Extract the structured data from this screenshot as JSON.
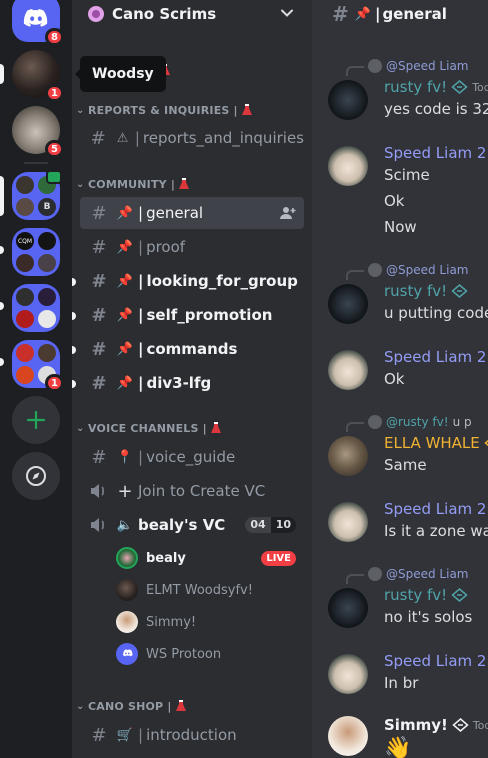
{
  "tooltip": "Woodsy",
  "rail": {
    "badges": [
      "8",
      "1",
      "5",
      "1"
    ],
    "mini_letter": "B",
    "mini_label_1": "CQM"
  },
  "guild": {
    "name": "Cano Scrims"
  },
  "sidebar": {
    "cat_reports": "REPORTS & INQUIRIES |",
    "cat_community": "COMMUNITY |",
    "cat_voice": "VOICE CHANNELS |",
    "cat_shop": "CANO SHOP |",
    "ch_reports": "reports_and_inquiries",
    "ch_general": "general",
    "ch_proof": "proof",
    "ch_lfg": "looking_for_group",
    "ch_promo": "self_promotion",
    "ch_commands": "commands",
    "ch_div3": "div3-lfg",
    "ch_voice_guide": "voice_guide",
    "ch_join_vc": "Join to Create VC",
    "ch_bealys_vc": "bealy's VC",
    "vc_count": "04",
    "vc_limit": "10",
    "voice_users": [
      "bealy",
      "ELMT Woodsyfv!",
      "Simmy!",
      "WS Protoon"
    ],
    "live_label": "LIVE",
    "ch_intro": "introduction",
    "bar": "|"
  },
  "chat": {
    "channel": "general",
    "messages": [
      {
        "reply_to": "@Speed Liam",
        "name": "rusty fv!",
        "time": "Toda",
        "text": "yes code is 3254",
        "color": "#4fa3a8"
      },
      {
        "name": "Speed Liam 2",
        "lines": [
          "Scime",
          "Ok",
          "Now"
        ],
        "color": "#949cf7"
      },
      {
        "reply_to": "@Speed Liam",
        "name": "rusty fv!",
        "text": "u putting code in",
        "color": "#4fa3a8"
      },
      {
        "name": "Speed Liam 2",
        "text": "Ok",
        "color": "#949cf7"
      },
      {
        "reply_to": "@rusty fv!",
        "reply_text": "u p",
        "name": "ELLA WHALE",
        "text": "Same",
        "color": "#f0b232"
      },
      {
        "name": "Speed Liam 2",
        "text": "Is it a zone wars",
        "color": "#949cf7"
      },
      {
        "reply_to": "@Speed Liam",
        "name": "rusty fv!",
        "text": "no it's solos",
        "color": "#4fa3a8"
      },
      {
        "name": "Speed Liam 2",
        "text": "In br",
        "color": "#949cf7"
      },
      {
        "name": "Simmy!",
        "time": "Today",
        "text": "👋",
        "color": "#f2f3f5"
      }
    ]
  }
}
